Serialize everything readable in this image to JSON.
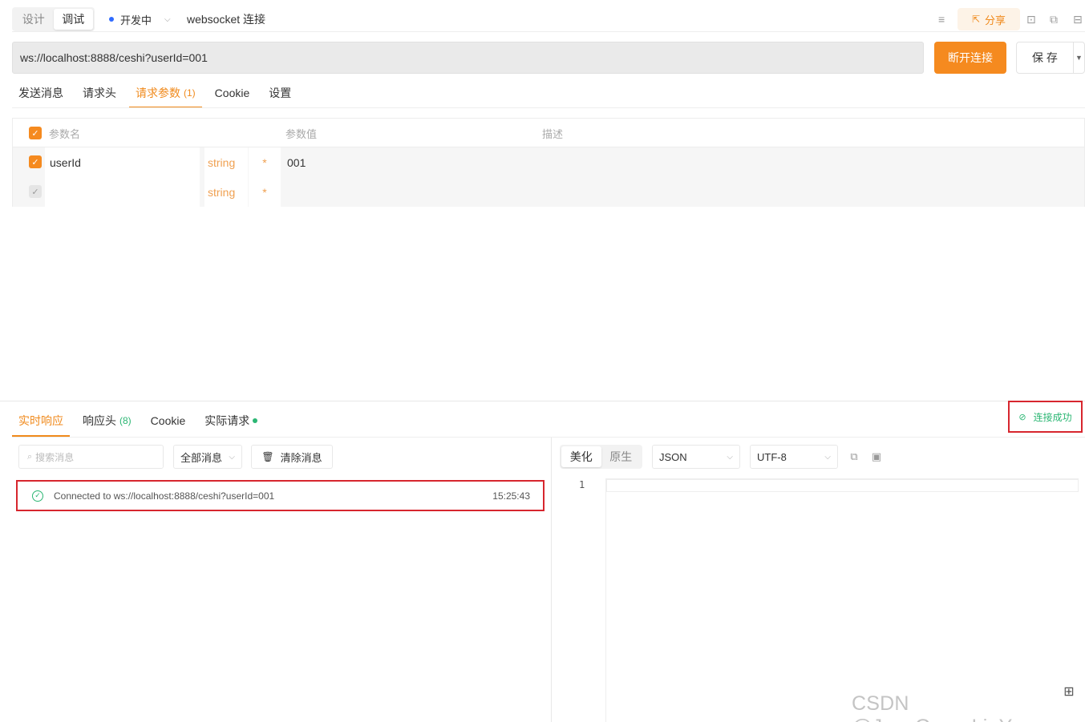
{
  "header": {
    "mode_tabs": [
      "设计",
      "调试"
    ],
    "active_mode": "调试",
    "status_label": "开发中",
    "endpoint_title": "websocket 连接",
    "share_label": "分享"
  },
  "url_bar": {
    "value": "ws://localhost:8888/ceshi?userId=001",
    "disconnect_label": "断开连接",
    "save_label": "保 存"
  },
  "request_tabs": [
    {
      "label": "发送消息",
      "count": ""
    },
    {
      "label": "请求头",
      "count": ""
    },
    {
      "label": "请求参数",
      "count": "(1)"
    },
    {
      "label": "Cookie",
      "count": ""
    },
    {
      "label": "设置",
      "count": ""
    }
  ],
  "params_table": {
    "headers": [
      "参数名",
      "参数值",
      "描述"
    ],
    "rows": [
      {
        "name": "userId",
        "type": "string",
        "required_mark": "*",
        "value": "001",
        "checked": true
      },
      {
        "name": "",
        "type": "string",
        "required_mark": "*",
        "value": "",
        "checked": false
      }
    ]
  },
  "response_tabs": [
    {
      "label": "实时响应",
      "count": ""
    },
    {
      "label": "响应头",
      "count": "(8)"
    },
    {
      "label": "Cookie",
      "count": ""
    },
    {
      "label": "实际请求",
      "count": ""
    }
  ],
  "connection_status": "连接成功",
  "message_panel": {
    "search_placeholder": "搜索消息",
    "filter_value": "全部消息",
    "clear_label": "清除消息",
    "messages": [
      {
        "text": "Connected to ws://localhost:8888/ceshi?userId=001",
        "time": "15:25:43"
      }
    ]
  },
  "viewer": {
    "format_tabs": [
      "美化",
      "原生"
    ],
    "language": "JSON",
    "encoding": "UTF-8",
    "line_number": "1"
  },
  "watermark": "CSDN @JavaGuru_LiuYu",
  "colors": {
    "accent": "#f58a1f",
    "success": "#2bb673",
    "highlight_box": "#d7262e"
  }
}
